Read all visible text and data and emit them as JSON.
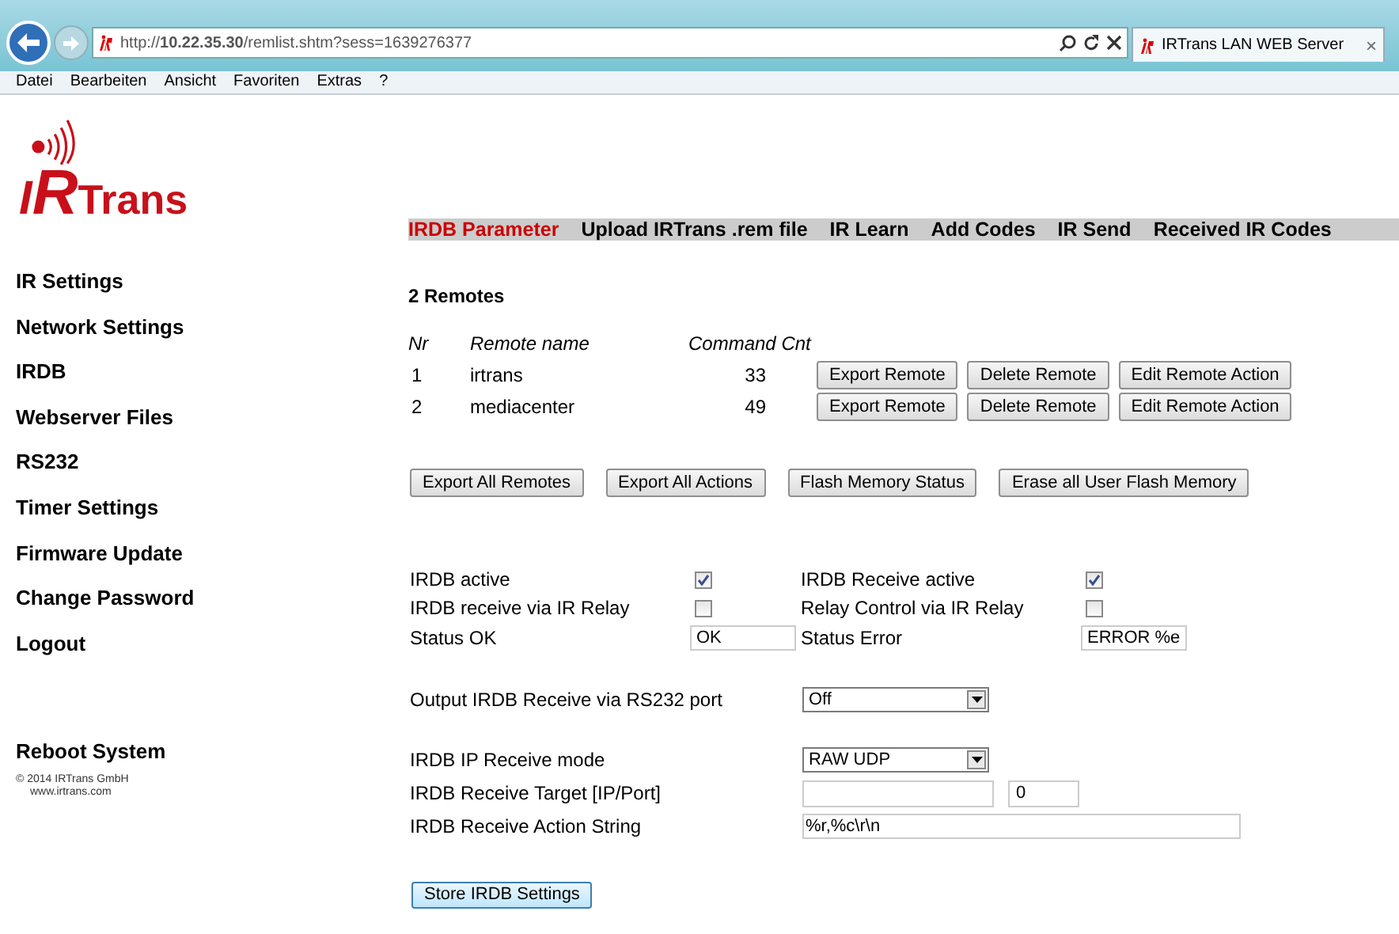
{
  "browser": {
    "url": "http://**10.22.35.30**/remlist.shtm?sess=1639276377",
    "tab": {
      "title": "IRTrans LAN WEB Server",
      "close": "×"
    },
    "menu": [
      "Datei",
      "Bearbeiten",
      "Ansicht",
      "Favoriten",
      "Extras",
      "?"
    ]
  },
  "logo": [
    "I",
    "R",
    "Trans"
  ],
  "sidebar": {
    "items": [
      "IR Settings",
      "Network Settings",
      "IRDB",
      "Webserver Files",
      "RS232",
      "Timer Settings",
      "Firmware Update",
      "Change Password",
      "Logout"
    ],
    "reboot": "Reboot System",
    "copyright": "© 2014 IRTrans GmbH",
    "website": "www.irtrans.com"
  },
  "nav": [
    {
      "label": "IRDB Parameter",
      "selected": true
    },
    {
      "label": "Upload IRTrans .rem file",
      "selected": false
    },
    {
      "label": "IR Learn",
      "selected": false
    },
    {
      "label": "Add Codes",
      "selected": false
    },
    {
      "label": "IR Send",
      "selected": false
    },
    {
      "label": "Received IR Codes",
      "selected": false
    }
  ],
  "heading": "2 Remotes",
  "table": {
    "columns": [
      "Nr",
      "Remote name",
      "Command Cnt"
    ],
    "rows": [
      {
        "nr": "1",
        "name": "irtrans",
        "count": "33",
        "actions": [
          "Export Remote",
          "Delete Remote",
          "Edit Remote Action"
        ]
      },
      {
        "nr": "2",
        "name": "mediacenter",
        "count": "49",
        "actions": [
          "Export Remote",
          "Delete Remote",
          "Edit Remote Action"
        ]
      }
    ]
  },
  "global_buttons": [
    "Export All Remotes",
    "Export All Actions",
    "Flash Memory Status",
    "Erase all User Flash Memory"
  ],
  "settings": [
    {
      "kind": "checkbox",
      "label": "IRDB active",
      "checked": true
    },
    {
      "kind": "checkbox",
      "label": "IRDB Receive active",
      "checked": true
    },
    {
      "kind": "checkbox",
      "label": "IRDB receive via IR Relay",
      "checked": false
    },
    {
      "kind": "checkbox",
      "label": "Relay Control via IR Relay",
      "checked": false
    },
    {
      "kind": "text",
      "label": "Status OK",
      "value": "OK"
    },
    {
      "kind": "text",
      "label": "Status Error",
      "value": "ERROR %e"
    }
  ],
  "output": {
    "label": "Output IRDB Receive via RS232 port",
    "value": "Off"
  },
  "ip": {
    "mode_label": "IRDB IP Receive mode",
    "mode": "RAW UDP",
    "target_label": "IRDB Receive Target [IP/Port]",
    "port": "0",
    "action_label": "IRDB Receive Action String",
    "action": "%r,%c\\r\\n"
  },
  "store": "Store IRDB Settings"
}
